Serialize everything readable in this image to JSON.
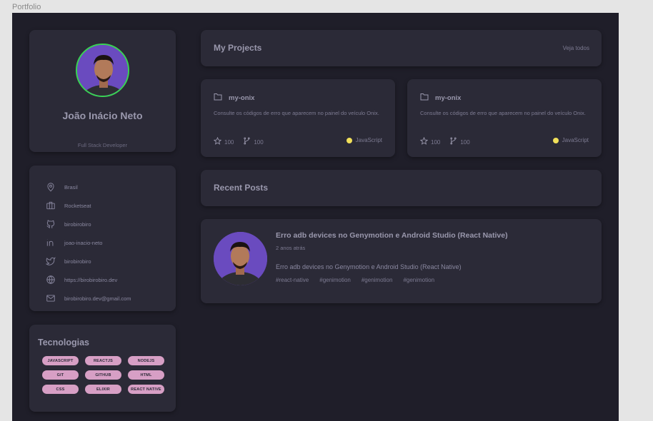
{
  "frame": {
    "label": "Portfolio"
  },
  "colors": {
    "background": "#1f1e29",
    "card": "#2b2a37",
    "text_primary": "#9a98ad",
    "text_secondary": "#7d7b92",
    "avatar_ring": "#39d353",
    "chip": "#d79fc5",
    "javascript_dot": "#f1e05a"
  },
  "profile": {
    "name": "João Inácio Neto",
    "role": "Full Stack Developer",
    "avatar_icon": "avatar-photo"
  },
  "info": {
    "items": [
      {
        "icon": "map-pin-icon",
        "text": "Brasil"
      },
      {
        "icon": "briefcase-icon",
        "text": "Rocketseat"
      },
      {
        "icon": "github-icon",
        "text": "birobirobiro"
      },
      {
        "icon": "linkedin-icon",
        "text": "joao-inacio-neto"
      },
      {
        "icon": "twitter-icon",
        "text": "birobirobiro"
      },
      {
        "icon": "globe-icon",
        "text": "https://birobirobiro.dev"
      },
      {
        "icon": "mail-icon",
        "text": "birobirobiro.dev@gmail.com"
      }
    ]
  },
  "tech": {
    "title": "Tecnologias",
    "chips": [
      "JAVASCRIPT",
      "REACTJS",
      "NODEJS",
      "GIT",
      "GITHUB",
      "HTML",
      "CSS",
      "ELIXIR",
      "REACT NATIVE"
    ]
  },
  "projects": {
    "title": "My Projects",
    "see_all": "Veja todos",
    "items": [
      {
        "name": "my-onix",
        "description": "Consulte os códigos de erro que aparecem no painel do veículo Onix.",
        "stars": "100",
        "forks": "100",
        "language": "JavaScript"
      },
      {
        "name": "my-onix",
        "description": "Consulte os códigos de erro que aparecem no painel do veículo Onix.",
        "stars": "100",
        "forks": "100",
        "language": "JavaScript"
      }
    ]
  },
  "posts": {
    "title": "Recent Posts",
    "items": [
      {
        "title": "Erro adb devices no Genymotion e Android Studio (React Native)",
        "date": "2 anos atrás",
        "excerpt": "Erro adb devices no Genymotion e Android Studio (React Native)",
        "tags": [
          "#react-native",
          "#genimotion",
          "#genimotion",
          "#genimotion"
        ]
      }
    ]
  }
}
